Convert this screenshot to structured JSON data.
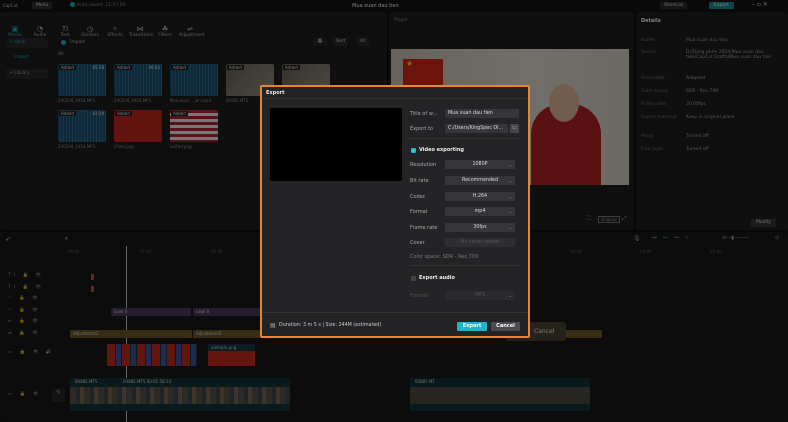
{
  "app": {
    "logo": "CapCut",
    "menu": "Menu",
    "autosave": "Auto saved: 21:07:50",
    "project_title": "Mua xuan dau tien",
    "shortcut": "Shortcut",
    "export": "Export"
  },
  "toolbar": [
    {
      "icon": "media-icon",
      "glyph": "▣",
      "label": "Media"
    },
    {
      "icon": "audio-icon",
      "glyph": "◔",
      "label": "Audio"
    },
    {
      "icon": "text-icon",
      "glyph": "TI",
      "label": "Text"
    },
    {
      "icon": "stickers-icon",
      "glyph": "◷",
      "label": "Stickers"
    },
    {
      "icon": "effects-icon",
      "glyph": "✧",
      "label": "Effects"
    },
    {
      "icon": "transitions-icon",
      "glyph": "⋈",
      "label": "Transitions"
    },
    {
      "icon": "filters-icon",
      "glyph": "☘",
      "label": "Filters"
    },
    {
      "icon": "adjustment-icon",
      "glyph": "⇌",
      "label": "Adjustment"
    }
  ],
  "sidebar": {
    "local": "• Local",
    "import": "Import",
    "library": "• Library"
  },
  "media": {
    "import": "Import",
    "sort": "Sort",
    "all_filter": "All",
    "all_heading": "All",
    "items": [
      {
        "tag": "Added",
        "duration": "05:38",
        "name": "240208_0918.MP3",
        "kind": "audio"
      },
      {
        "tag": "Added",
        "duration": "06:43",
        "name": "240208_0924.MP3",
        "kind": "audio"
      },
      {
        "tag": "Added",
        "duration": "",
        "name": "Mua xuan ...ien.mp3",
        "kind": "audio"
      },
      {
        "tag": "Added",
        "duration": "",
        "name": "00885.MTS",
        "kind": "video"
      },
      {
        "tag": "Added",
        "duration": "",
        "name": "00887.MTS",
        "kind": "video"
      },
      {
        "tag": "Added",
        "duration": "02:19",
        "name": "240208_1454.MP3",
        "kind": "audio"
      },
      {
        "tag": "Added",
        "duration": "",
        "name": "china.png",
        "kind": "china"
      },
      {
        "tag": "Added",
        "duration": "",
        "name": "united.png",
        "kind": "usa"
      }
    ]
  },
  "player": {
    "title": "Player",
    "ratio": "Original"
  },
  "details": {
    "title": "Details",
    "rows": [
      {
        "k": "Name:",
        "v": "Mua xuan dau tien"
      },
      {
        "k": "Saved:",
        "v": "D:/Dung phim 2024/Mua xuan dau tien/CapCut Drafts/Mua xuan dau tien"
      },
      {
        "k": "Resolution:",
        "v": "Adapted"
      },
      {
        "k": "Color space:",
        "v": "SDR - Rec.709"
      },
      {
        "k": "Frame rate:",
        "v": "30.00fps"
      },
      {
        "k": "Import material:",
        "v": "Keep in original place"
      },
      {
        "k": "Proxy:",
        "v": "Turned off"
      },
      {
        "k": "Free layer:",
        "v": "Turned off"
      }
    ],
    "modify": "Modify"
  },
  "timeline": {
    "ruler": [
      "00:00",
      "01:00",
      "02:00"
    ],
    "ruler_right": [
      "03:00",
      "04:00",
      "05:00"
    ],
    "clips": {
      "leak1": "Leak II",
      "leak2": "Leak II",
      "adj1": "Adjustment2",
      "adj2": "Adjustment2",
      "vietnam": "vietnam.png",
      "main1": "00885.MTS",
      "main2": "00885.MTS  00:01:58:14",
      "main3": "00887.MT"
    },
    "bg_cancel": "Cancel"
  },
  "export_dialog": {
    "title": "Export",
    "title_label": "Title of w...",
    "title_value": "Mua xuan dau tien",
    "export_to_label": "Export to",
    "export_to_value": "C:/Users/KingSpec Ol...",
    "video_section": "Video exporting",
    "video_checked": true,
    "resolution_label": "Resolution",
    "resolution": "1080P",
    "bitrate_label": "Bit rate",
    "bitrate": "Recommended",
    "codec_label": "Codec",
    "codec": "H.264",
    "format_label": "Format",
    "format": "mp4",
    "framerate_label": "Frame rate",
    "framerate": "30fps",
    "cover_label": "Cover",
    "cover": "No cover added",
    "color_space": "Color space: SDR - Rec.709",
    "audio_section": "Export audio",
    "audio_checked": false,
    "audio_format_label": "Format",
    "audio_format": "MP3",
    "footer": "Duration: 3 m 5 s | Size: 244M (estimated)",
    "export_btn": "Export",
    "cancel_btn": "Cancel",
    "accent": "#1fb5c6",
    "border": "#e8832e"
  }
}
